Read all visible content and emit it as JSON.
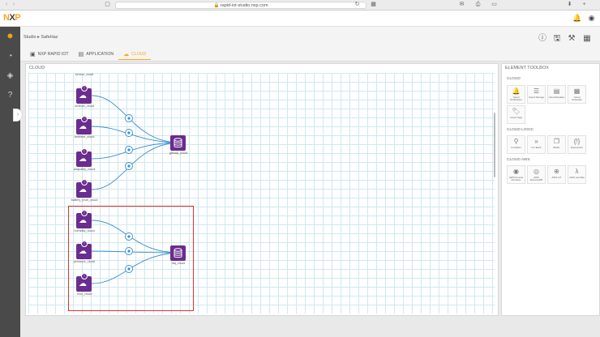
{
  "browser": {
    "url": "rapid-iot-studio.nxp.com"
  },
  "header": {
    "logo_part1": "N",
    "logo_part2": "X",
    "logo_part3": "P"
  },
  "subheader": {
    "breadcrumb": "Studio ▸   SafeHaz",
    "tabs": [
      {
        "label": "NXP RAPID IOT",
        "icon": "chip-icon"
      },
      {
        "label": "APPLICATION",
        "icon": "app-icon"
      },
      {
        "label": "CLOUD",
        "icon": "cloud-icon"
      }
    ]
  },
  "canvas": {
    "title": "CLOUD",
    "nodes_top": [
      {
        "label": "luxlevel_cloud"
      },
      {
        "label": "ambient_cloud"
      },
      {
        "label": "airquality_cloud"
      },
      {
        "label": "battery_level_cloud"
      }
    ],
    "top_target": {
      "label": "gasaqi_cloud"
    },
    "nodes_bottom": [
      {
        "label": "humidity_cloud"
      },
      {
        "label": "pressure_cloud"
      },
      {
        "label": "tvoc_cloud"
      }
    ],
    "bottom_target": {
      "label": "iaq_cloud"
    },
    "top_first_label": "sensor_cloud"
  },
  "toolbox": {
    "title": "ELEMENT TOOLBOX",
    "sections": [
      {
        "title": "CLOUD",
        "items": [
          {
            "label": "Cloud Notification",
            "icon": "bell-icon"
          },
          {
            "label": "Cloud Storage",
            "icon": "database-icon"
          },
          {
            "label": "Cloud Replace",
            "icon": "replace-icon"
          },
          {
            "label": "Cloud Schedule",
            "icon": "calendar-icon"
          },
          {
            "label": "Cloud Tags",
            "icon": "tag-icon"
          }
        ]
      },
      {
        "title": "CLOUD LOGIC",
        "items": [
          {
            "label": "Condition",
            "icon": "condition-icon"
          },
          {
            "label": "For Each",
            "icon": "foreach-icon"
          },
          {
            "label": "Buffer",
            "icon": "buffer-icon"
          },
          {
            "label": "Expression",
            "icon": "expression-icon"
          }
        ]
      },
      {
        "title": "CLOUD AWS",
        "items": [
          {
            "label": "AWS Kinesis Firehose",
            "icon": "kinesis-icon"
          },
          {
            "label": "AWS DynamoDB",
            "icon": "dynamodb-icon"
          },
          {
            "label": "AWS IoT",
            "icon": "awsiot-icon"
          },
          {
            "label": "AWS Lambda",
            "icon": "lambda-icon"
          }
        ]
      }
    ]
  },
  "colors": {
    "accent": "#f5a623",
    "node": "#6a2c8e",
    "wire": "#3a8fd0",
    "highlight": "#e03030"
  }
}
